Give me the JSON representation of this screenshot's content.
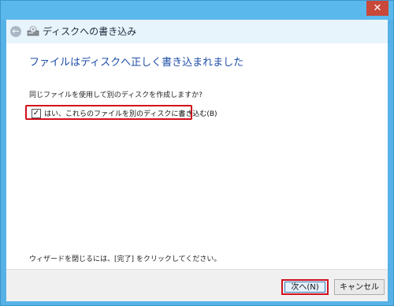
{
  "window": {
    "close_symbol": "✕"
  },
  "header": {
    "title": "ディスクへの書き込み",
    "back_symbol": "←"
  },
  "content": {
    "main_instruction": "ファイルはディスクへ正しく書き込まれました",
    "question": "同じファイルを使用して別のディスクを作成しますか?",
    "checkbox": {
      "label": "はい、これらのファイルを別のディスクに書き込む(B)",
      "checked": true,
      "check_symbol": "✓"
    },
    "footer_text": "ウィザードを閉じるには、[完了] をクリックしてください。"
  },
  "buttons": {
    "next_label": "次へ(N)",
    "cancel_label": "キャンセル"
  },
  "colors": {
    "titlebar": "#5ab8ec",
    "close_button": "#c94839",
    "highlight": "#d2101c",
    "instruction_text": "#1e4ea8"
  }
}
